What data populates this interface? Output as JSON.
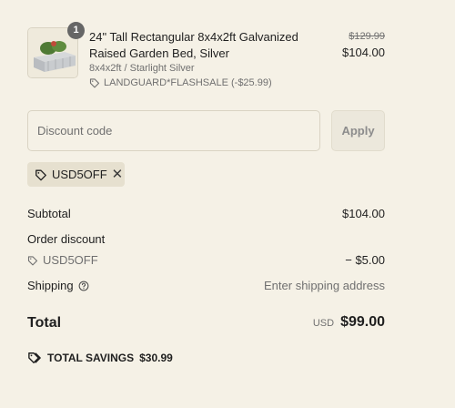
{
  "product": {
    "quantity": "1",
    "title": "24\" Tall Rectangular 8x4x2ft Galvanized Raised Garden Bed, Silver",
    "variant": "8x4x2ft / Starlight Silver",
    "discount_tag": "LANDGUARD*FLASHSALE (-$25.99)",
    "price_original": "$129.99",
    "price_current": "$104.00"
  },
  "discount": {
    "placeholder": "Discount code",
    "value": "",
    "apply_label": "Apply"
  },
  "applied_code": {
    "label": "USD5OFF",
    "remove_glyph": "✕"
  },
  "summary": {
    "subtotal_label": "Subtotal",
    "subtotal_value": "$104.00",
    "order_discount_label": "Order discount",
    "order_discount_code": "USD5OFF",
    "order_discount_value": "− $5.00",
    "shipping_label": "Shipping",
    "shipping_value": "Enter shipping address",
    "total_label": "Total",
    "total_currency": "USD",
    "total_value": "$99.00",
    "savings_label": "TOTAL SAVINGS",
    "savings_value": "$30.99"
  },
  "icons": {
    "tag": "tag-icon",
    "tags": "tags-icon",
    "help": "help-circle-icon",
    "close": "close-icon"
  }
}
